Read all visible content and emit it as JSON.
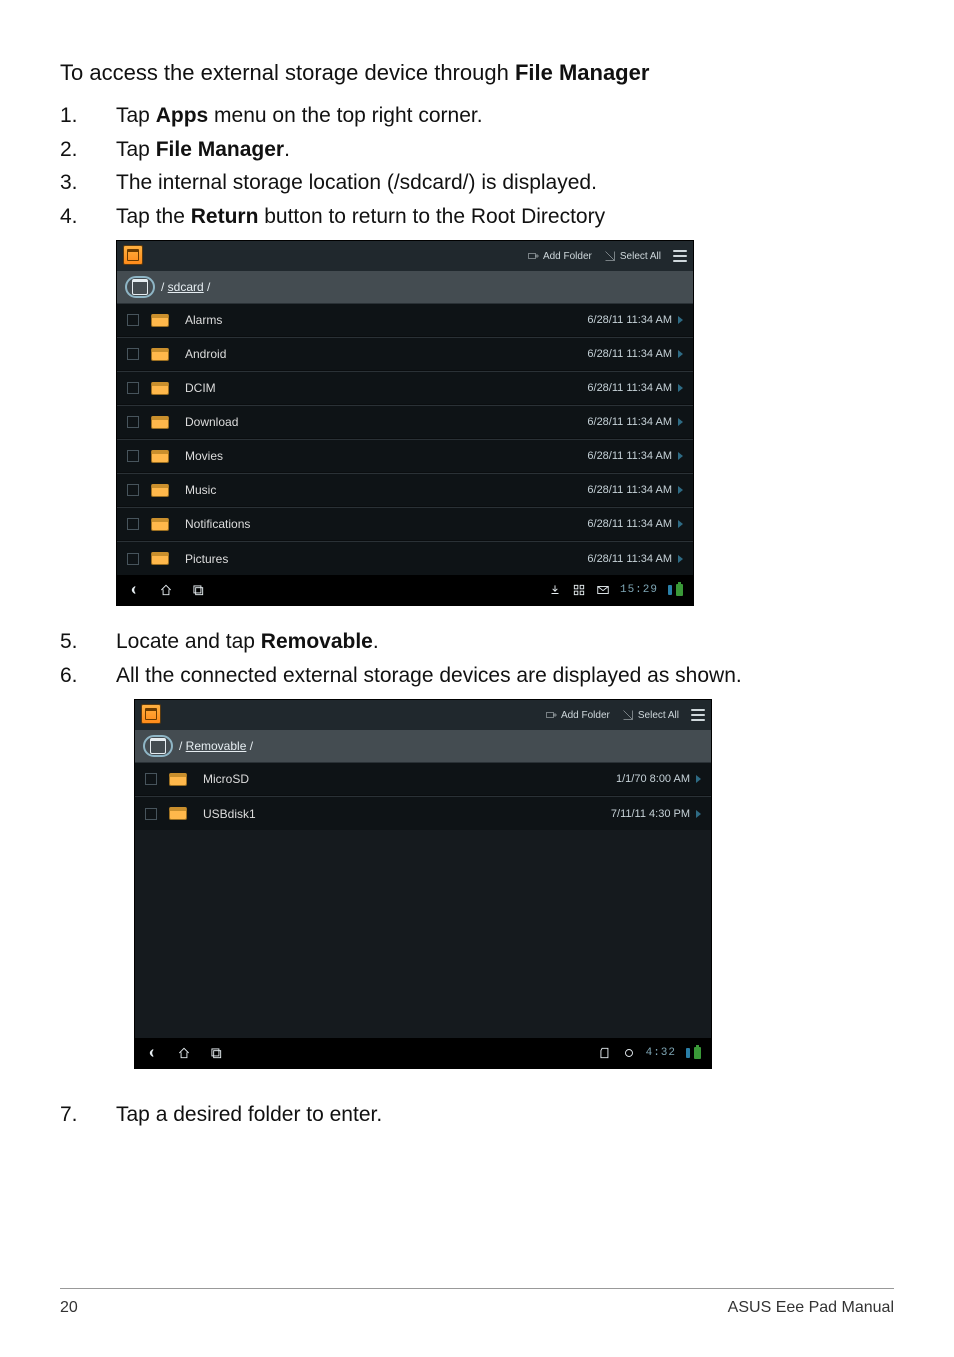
{
  "intro_pre": "To access the external storage device through ",
  "intro_bold": "File Manager",
  "steps_a": [
    {
      "n": "1.",
      "pre": "Tap ",
      "bold": "Apps",
      "post": " menu on the top right corner."
    },
    {
      "n": "2.",
      "pre": "Tap ",
      "bold": "File Manager",
      "post": "."
    },
    {
      "n": "3.",
      "pre": "The internal storage location (/sdcard/) is displayed.",
      "bold": "",
      "post": ""
    },
    {
      "n": "4.",
      "pre": "Tap the ",
      "bold": "Return",
      "post": " button to return to the Root Directory"
    }
  ],
  "steps_b": [
    {
      "n": "5.",
      "pre": "Locate and tap ",
      "bold": "Removable",
      "post": "."
    },
    {
      "n": "6.",
      "pre": "All the connected external storage devices are displayed as shown.",
      "bold": "",
      "post": ""
    }
  ],
  "steps_c": [
    {
      "n": "7.",
      "pre": "Tap a desired folder to enter.",
      "bold": "",
      "post": ""
    }
  ],
  "fm": {
    "add_folder": "Add Folder",
    "select_all": "Select All"
  },
  "shot1": {
    "path_seg": "sdcard",
    "rows": [
      {
        "name": "Alarms",
        "time": "6/28/11 11:34 AM"
      },
      {
        "name": "Android",
        "time": "6/28/11 11:34 AM"
      },
      {
        "name": "DCIM",
        "time": "6/28/11 11:34 AM"
      },
      {
        "name": "Download",
        "time": "6/28/11 11:34 AM"
      },
      {
        "name": "Movies",
        "time": "6/28/11 11:34 AM"
      },
      {
        "name": "Music",
        "time": "6/28/11 11:34 AM"
      },
      {
        "name": "Notifications",
        "time": "6/28/11 11:34 AM"
      },
      {
        "name": "Pictures",
        "time": "6/28/11 11:34 AM"
      }
    ],
    "clock": "15:29"
  },
  "shot2": {
    "path_seg": "Removable",
    "rows": [
      {
        "name": "MicroSD",
        "time": "1/1/70 8:00 AM"
      },
      {
        "name": "USBdisk1",
        "time": "7/11/11 4:30 PM"
      }
    ],
    "clock": "4:32"
  },
  "footer": {
    "page": "20",
    "title": "ASUS Eee Pad Manual"
  }
}
